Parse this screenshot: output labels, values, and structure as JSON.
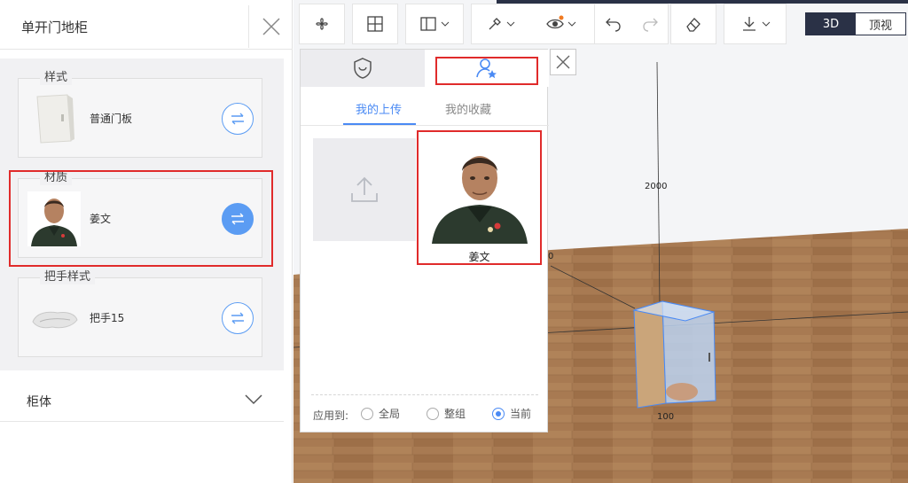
{
  "left_panel": {
    "title": "单开门地柜",
    "cards": [
      {
        "legend": "样式",
        "name": "普通门板"
      },
      {
        "legend": "材质",
        "name": "姜文"
      },
      {
        "legend": "把手样式",
        "name": "把手15"
      }
    ],
    "section_body": "柜体"
  },
  "toolbar": {
    "view_modes": [
      "3D",
      "顶视"
    ],
    "active_view": "3D"
  },
  "viewport": {
    "dim_top": "2000",
    "dim_bottom": "100",
    "dim_side": "0"
  },
  "popup": {
    "subtabs": [
      "我的上传",
      "我的收藏"
    ],
    "material_name": "姜文",
    "apply_label": "应用到:",
    "apply_options": [
      "全局",
      "整组",
      "当前"
    ],
    "apply_selected": "当前"
  },
  "colors": {
    "accent_blue": "#4a8af4",
    "highlight_red": "#e02b2b",
    "toolbar_dark": "#2a3146",
    "floor_wood": "#a87a52"
  }
}
